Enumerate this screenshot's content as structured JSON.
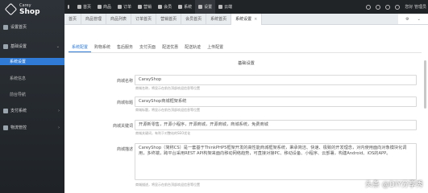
{
  "brand": {
    "line1": "Carey",
    "line2": "Shop"
  },
  "sidebar": {
    "items": [
      {
        "label": "设置首页"
      },
      {
        "label": "基础设置",
        "arrow": "⌄"
      },
      {
        "label": "系统设置",
        "active": true
      },
      {
        "label": "系统信息"
      },
      {
        "label": "前台导航"
      },
      {
        "label": "支付系统",
        "arrow": "›"
      },
      {
        "label": "物流管控",
        "arrow": "›"
      }
    ]
  },
  "topnav": {
    "items": [
      {
        "label": "首页"
      },
      {
        "label": "商品"
      },
      {
        "label": "订单"
      },
      {
        "label": "营销"
      },
      {
        "label": "会员"
      },
      {
        "label": "系统"
      },
      {
        "label": "设置"
      },
      {
        "label": "云端"
      }
    ],
    "user": "您好 管理员"
  },
  "tabs": {
    "items": [
      {
        "label": "首页"
      },
      {
        "label": "商品管理"
      },
      {
        "label": "商品列表"
      },
      {
        "label": "订单首页"
      },
      {
        "label": "营销首页"
      },
      {
        "label": "会员首页"
      },
      {
        "label": "系统首页"
      },
      {
        "label": "系统设置"
      }
    ]
  },
  "subtabs": {
    "items": [
      {
        "label": "系统配置",
        "active": true
      },
      {
        "label": "购物系统"
      },
      {
        "label": "售后服务"
      },
      {
        "label": "支付页面"
      },
      {
        "label": "配送优惠"
      },
      {
        "label": "配送轨迹"
      },
      {
        "label": "上传配置"
      }
    ]
  },
  "section_title": "基础设置",
  "fields": {
    "name": {
      "label": "商城名称",
      "value": "CarayShop",
      "help": "商城名称，将显示在前台顶部欢迎信息等位置"
    },
    "title": {
      "label": "商城标题",
      "value": "CarayShop商城框架系统",
      "help": "商城标题，将显示在前台顶部欢迎信息等位置"
    },
    "keywords": {
      "label": "商城关键词",
      "value": "开源新零售，开源小程序，开源商城，开源商城，商城系统，免费商城",
      "help": "商城关键词，有利于对整站的SEO优化"
    },
    "desc": {
      "label": "商城描述",
      "value": "CareyShop（简称CS）是一套基于ThinkPHP5框架开发的高性能商城框架系统，秉承简洁、快速、极致的开发理念，对内使用面向对象模块化调用，多终端，跨平台采用REST API构架来面向移动网络趋势，可直接对接PC、移动设备、小程序、云部署，构建Android、iOS的APP。",
      "help": "商城描述，将显示在前台顶部欢迎信息等位置"
    }
  },
  "watermark": "头条 @DIY分享秀"
}
